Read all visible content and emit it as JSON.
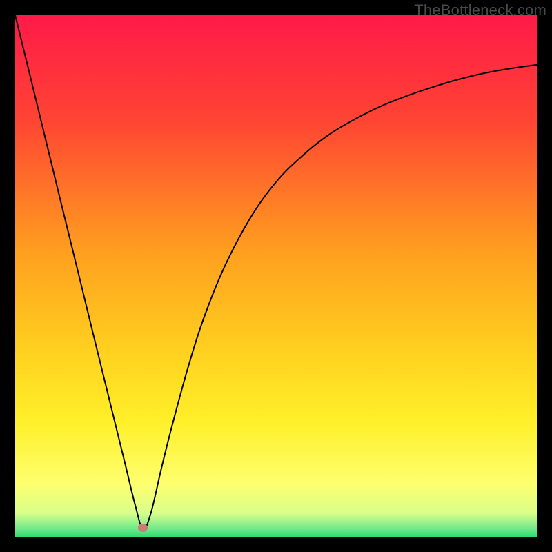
{
  "watermark": "TheBottleneck.com",
  "marker": {
    "color": "#c87f73",
    "x_pct": 24.5,
    "y_pct": 98.3
  },
  "chart_data": {
    "type": "line",
    "title": "",
    "xlabel": "",
    "ylabel": "",
    "xlim": [
      0,
      100
    ],
    "ylim": [
      0,
      100
    ],
    "grid": false,
    "background_gradient": {
      "type": "vertical",
      "stops": [
        {
          "pos": 0.0,
          "color": "#ff1a49"
        },
        {
          "pos": 0.2,
          "color": "#ff4433"
        },
        {
          "pos": 0.45,
          "color": "#ff9e1f"
        },
        {
          "pos": 0.65,
          "color": "#ffd21f"
        },
        {
          "pos": 0.78,
          "color": "#fff02a"
        },
        {
          "pos": 0.9,
          "color": "#fdff70"
        },
        {
          "pos": 0.955,
          "color": "#d9ff8a"
        },
        {
          "pos": 0.985,
          "color": "#6fe88a"
        },
        {
          "pos": 1.0,
          "color": "#2bdc73"
        }
      ]
    },
    "series": [
      {
        "name": "bottleneck-curve",
        "color": "#000000",
        "stroke_width": 2,
        "x": [
          0,
          3,
          6,
          9,
          12,
          15,
          18,
          21,
          23,
          24.5,
          26,
          28,
          30,
          33,
          36,
          40,
          45,
          50,
          55,
          60,
          65,
          70,
          75,
          80,
          85,
          90,
          95,
          100
        ],
        "y": [
          100,
          87.8,
          75.5,
          63.2,
          51.0,
          38.7,
          26.5,
          14.3,
          6.1,
          1.5,
          4.5,
          13.0,
          21.0,
          32.0,
          41.5,
          51.5,
          61.0,
          68.0,
          73.0,
          77.0,
          80.0,
          82.5,
          84.5,
          86.2,
          87.7,
          88.9,
          89.8,
          90.5
        ]
      }
    ],
    "markers": [
      {
        "x": 24.5,
        "y": 1.7,
        "color": "#c87f73",
        "shape": "ellipse"
      }
    ]
  }
}
